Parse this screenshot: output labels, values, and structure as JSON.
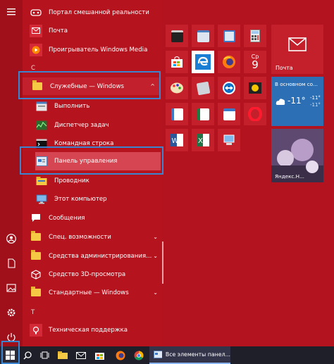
{
  "rail": {
    "items": [
      "hamburger-menu-icon",
      "user-avatar-icon",
      "document-icon",
      "pictures-icon",
      "settings-gear-icon",
      "power-icon"
    ]
  },
  "apps": {
    "mixed_reality_portal": "Портал смешанной реальности",
    "mail": "Почта",
    "windows_media_player": "Проигрыватель Windows Media",
    "section_c": "С",
    "windows_tools_folder": "Служебные — Windows",
    "run": "Выполнить",
    "task_manager": "Диспетчер задач",
    "command_prompt": "Командная строка",
    "control_panel": "Панель управления",
    "explorer": "Проводник",
    "this_pc": "Этот компьютер",
    "messages": "Сообщения",
    "accessibility": "Спец. возможности",
    "admin_tools": "Средства администрирования...",
    "view_3d": "Средство 3D-просмотра",
    "standard_windows": "Стандартные — Windows",
    "section_t": "Т",
    "tech_support": "Техническая поддержка"
  },
  "tiles": {
    "calendar_day_name": "Ср",
    "calendar_day_number": "9",
    "mail_label": "Почта",
    "weather_location": "В основном со...",
    "weather_temp": "-11°",
    "weather_low": "-11°",
    "weather_high": "-11°",
    "news_caption": "Яндекс.Н..."
  },
  "taskbar": {
    "window_title": "Все элементы панел..."
  },
  "colors": {
    "accent_red": "#b3131f",
    "highlight_blue": "#3a84d0",
    "taskbar": "#1f1f2a"
  }
}
